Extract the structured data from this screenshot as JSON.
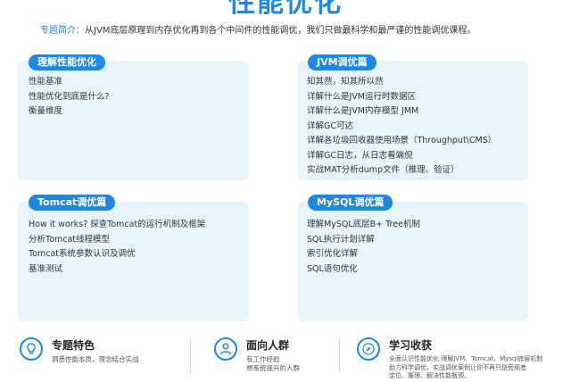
{
  "header": {
    "title": "性能优化",
    "intro_label": "专题简介：",
    "intro_text": "从JVM底层原理到内存优化再到各个中间件的性能调优，我们只做最科学和最严谨的性能调优课程。"
  },
  "cards": [
    {
      "title": "理解性能优化",
      "items": [
        "性能基准",
        "性能优化到底是什么?",
        "衡量维度"
      ]
    },
    {
      "title": "JVM调优篇",
      "items": [
        "知其然，知其所以然",
        "详解什么是JVM运行时数据区",
        "详解什么是JVM内存模型 JMM",
        "详解GC可达",
        "详解各垃圾回收器使用场景（Throughput\\CMS）",
        "详解GC日志，从日志看端倪",
        "实战MAT分析dump文件（推理、验证）"
      ]
    },
    {
      "title": "Tomcat调优篇",
      "items": [
        "How it works? 探查Tomcat的运行机制及框架",
        "分析Tomcat线程模型",
        "Tomcat系统参数认识及调优",
        "基准测试"
      ]
    },
    {
      "title": "MySQL调优篇",
      "items": [
        "理解MySQL底层B+ Tree机制",
        "SQL执行计划详解",
        "索引优化详解",
        "SQL语句优化"
      ]
    }
  ],
  "features": [
    {
      "icon": "lightbulb-icon",
      "title": "专题特色",
      "desc": [
        "洞悉性能本质，理念结合实战"
      ]
    },
    {
      "icon": "person-icon",
      "title": "面向人群",
      "desc": [
        "有工作经验",
        "想系统提升的人群"
      ]
    },
    {
      "icon": "compass-icon",
      "title": "学习收获",
      "desc": [
        "全面认识性能优化 理解JVM、Tomcat、Mysql底层机制",
        "助力科学调优，实战调优案例让你不再只是旁观者",
        "定位、推理、解决性能瓶颈。"
      ]
    }
  ],
  "colors": {
    "accent": "#1e88e5",
    "card_bg": "#e8f4fc"
  }
}
